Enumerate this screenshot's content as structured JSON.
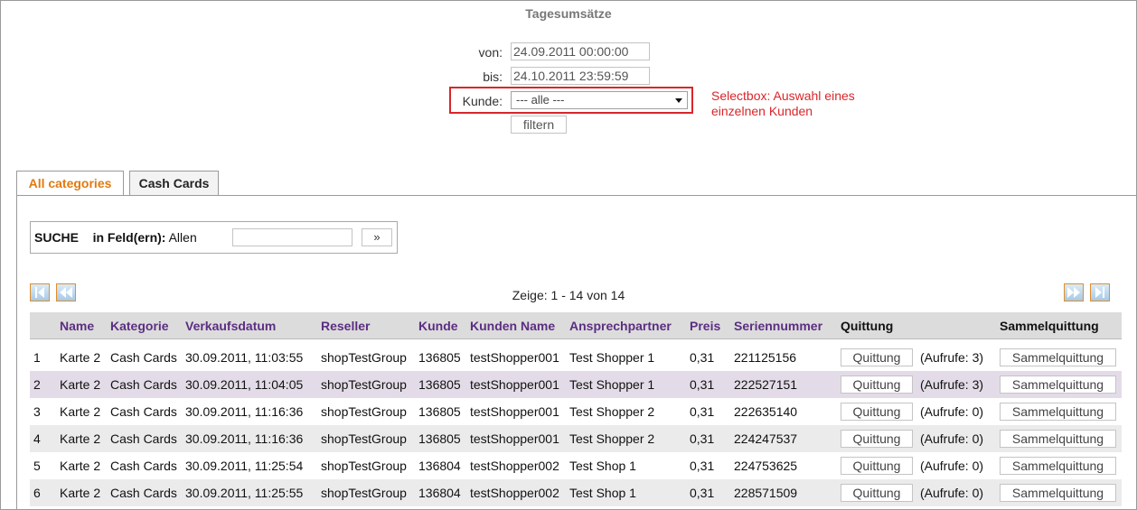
{
  "page": {
    "title": "Tagesumsätze"
  },
  "filter": {
    "von_label": "von:",
    "von_value": "24.09.2011 00:00:00",
    "bis_label": "bis:",
    "bis_value": "24.10.2011 23:59:59",
    "kunde_label": "Kunde:",
    "kunde_selected": "--- alle ---",
    "filter_button": "filtern"
  },
  "annotation": {
    "line1": "Selectbox: Auswahl eines",
    "line2": "einzelnen Kunden",
    "color": "#d9262a"
  },
  "tabs": [
    {
      "label": "All categories",
      "active": true
    },
    {
      "label": "Cash Cards",
      "active": false
    }
  ],
  "search": {
    "label": "SUCHE",
    "field_label": "in Feld(ern):",
    "field_value": "Allen",
    "go_label": "»"
  },
  "pager": {
    "text": "Zeige: 1 - 14 von 14"
  },
  "table": {
    "columns": [
      "",
      "Name",
      "Kategorie",
      "Verkaufsdatum",
      "Reseller",
      "Kunde",
      "Kunden Name",
      "Ansprechpartner",
      "Preis",
      "Seriennummer",
      "Quittung",
      "",
      "Sammelquittung"
    ],
    "quittung_button": "Quittung",
    "sammel_button": "Sammelquittung",
    "rows": [
      {
        "nr": "1",
        "name": "Karte 2",
        "kategorie": "Cash Cards",
        "datum": "30.09.2011, 11:03:55",
        "reseller": "shopTestGroup",
        "kunde": "136805",
        "kundenname": "testShopper001",
        "ansprech": "Test Shopper 1",
        "preis": "0,31",
        "serien": "221125156",
        "aufrufe": "(Aufrufe: 3)"
      },
      {
        "nr": "2",
        "name": "Karte 2",
        "kategorie": "Cash Cards",
        "datum": "30.09.2011, 11:04:05",
        "reseller": "shopTestGroup",
        "kunde": "136805",
        "kundenname": "testShopper001",
        "ansprech": "Test Shopper 1",
        "preis": "0,31",
        "serien": "222527151",
        "aufrufe": "(Aufrufe: 3)"
      },
      {
        "nr": "3",
        "name": "Karte 2",
        "kategorie": "Cash Cards",
        "datum": "30.09.2011, 11:16:36",
        "reseller": "shopTestGroup",
        "kunde": "136805",
        "kundenname": "testShopper001",
        "ansprech": "Test Shopper 2",
        "preis": "0,31",
        "serien": "222635140",
        "aufrufe": "(Aufrufe: 0)"
      },
      {
        "nr": "4",
        "name": "Karte 2",
        "kategorie": "Cash Cards",
        "datum": "30.09.2011, 11:16:36",
        "reseller": "shopTestGroup",
        "kunde": "136805",
        "kundenname": "testShopper001",
        "ansprech": "Test Shopper 2",
        "preis": "0,31",
        "serien": "224247537",
        "aufrufe": "(Aufrufe: 0)"
      },
      {
        "nr": "5",
        "name": "Karte 2",
        "kategorie": "Cash Cards",
        "datum": "30.09.2011, 11:25:54",
        "reseller": "shopTestGroup",
        "kunde": "136804",
        "kundenname": "testShopper002",
        "ansprech": "Test Shop 1",
        "preis": "0,31",
        "serien": "224753625",
        "aufrufe": "(Aufrufe: 0)"
      },
      {
        "nr": "6",
        "name": "Karte 2",
        "kategorie": "Cash Cards",
        "datum": "30.09.2011, 11:25:55",
        "reseller": "shopTestGroup",
        "kunde": "136804",
        "kundenname": "testShopper002",
        "ansprech": "Test Shop 1",
        "preis": "0,31",
        "serien": "228571509",
        "aufrufe": "(Aufrufe: 0)"
      }
    ]
  },
  "colors": {
    "accent": "#e07a10",
    "header_text": "#5c2e82",
    "highlight_row": "#e3dce8"
  }
}
